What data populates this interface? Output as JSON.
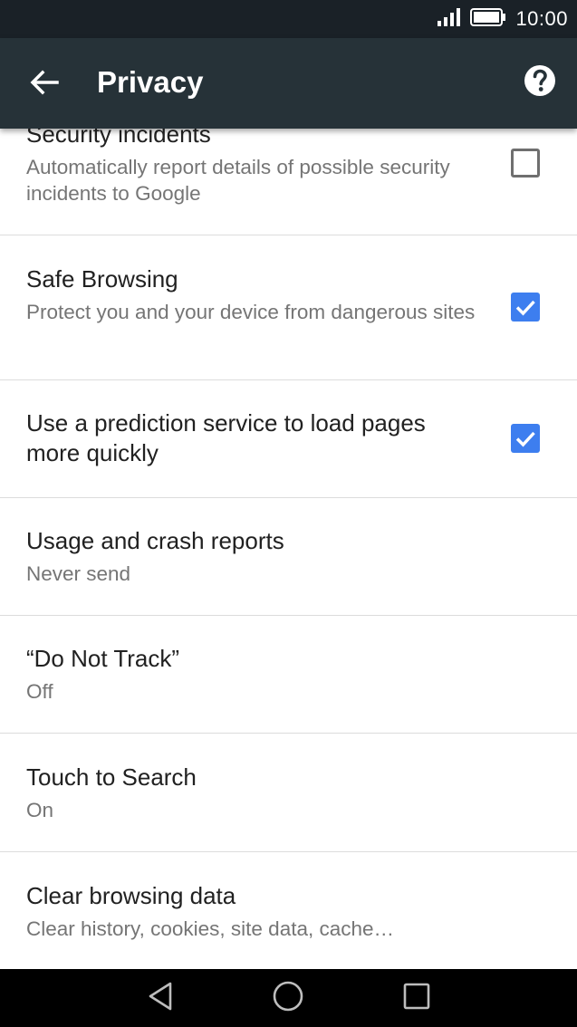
{
  "status_bar": {
    "time": "10:00"
  },
  "app_bar": {
    "title": "Privacy"
  },
  "settings": [
    {
      "title": "Security incidents",
      "subtitle": "Automatically report details of possible security incidents to Google",
      "checked": false
    },
    {
      "title": "Safe Browsing",
      "subtitle": "Protect you and your device from dangerous sites",
      "checked": true
    },
    {
      "title": "Use a prediction service to load pages more quickly",
      "checked": true
    },
    {
      "title": "Usage and crash reports",
      "subtitle": "Never send"
    },
    {
      "title": "“Do Not Track”",
      "subtitle": "Off"
    },
    {
      "title": "Touch to Search",
      "subtitle": "On"
    },
    {
      "title": "Clear browsing data",
      "subtitle": "Clear history, cookies, site data, cache…"
    }
  ],
  "colors": {
    "app_bar": "#263238",
    "status_bar": "#1a2127",
    "checkbox_checked": "#3d7eef"
  }
}
